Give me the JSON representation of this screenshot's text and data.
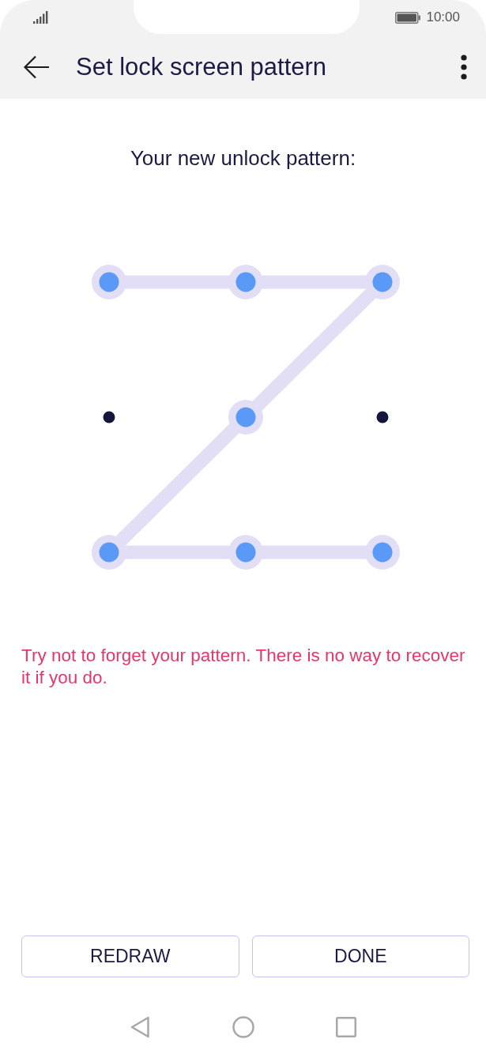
{
  "status_bar": {
    "time": "10:00"
  },
  "app_bar": {
    "title": "Set lock screen pattern"
  },
  "prompt": "Your new unlock pattern:",
  "pattern": {
    "dots": [
      {
        "selected": true
      },
      {
        "selected": true
      },
      {
        "selected": true
      },
      {
        "selected": false
      },
      {
        "selected": true
      },
      {
        "selected": false
      },
      {
        "selected": true
      },
      {
        "selected": true
      },
      {
        "selected": true
      }
    ]
  },
  "warning": "Try not to forget your pattern. There is no way to recover it if you do.",
  "buttons": [
    {
      "label": "REDRAW"
    },
    {
      "label": "DONE"
    }
  ]
}
